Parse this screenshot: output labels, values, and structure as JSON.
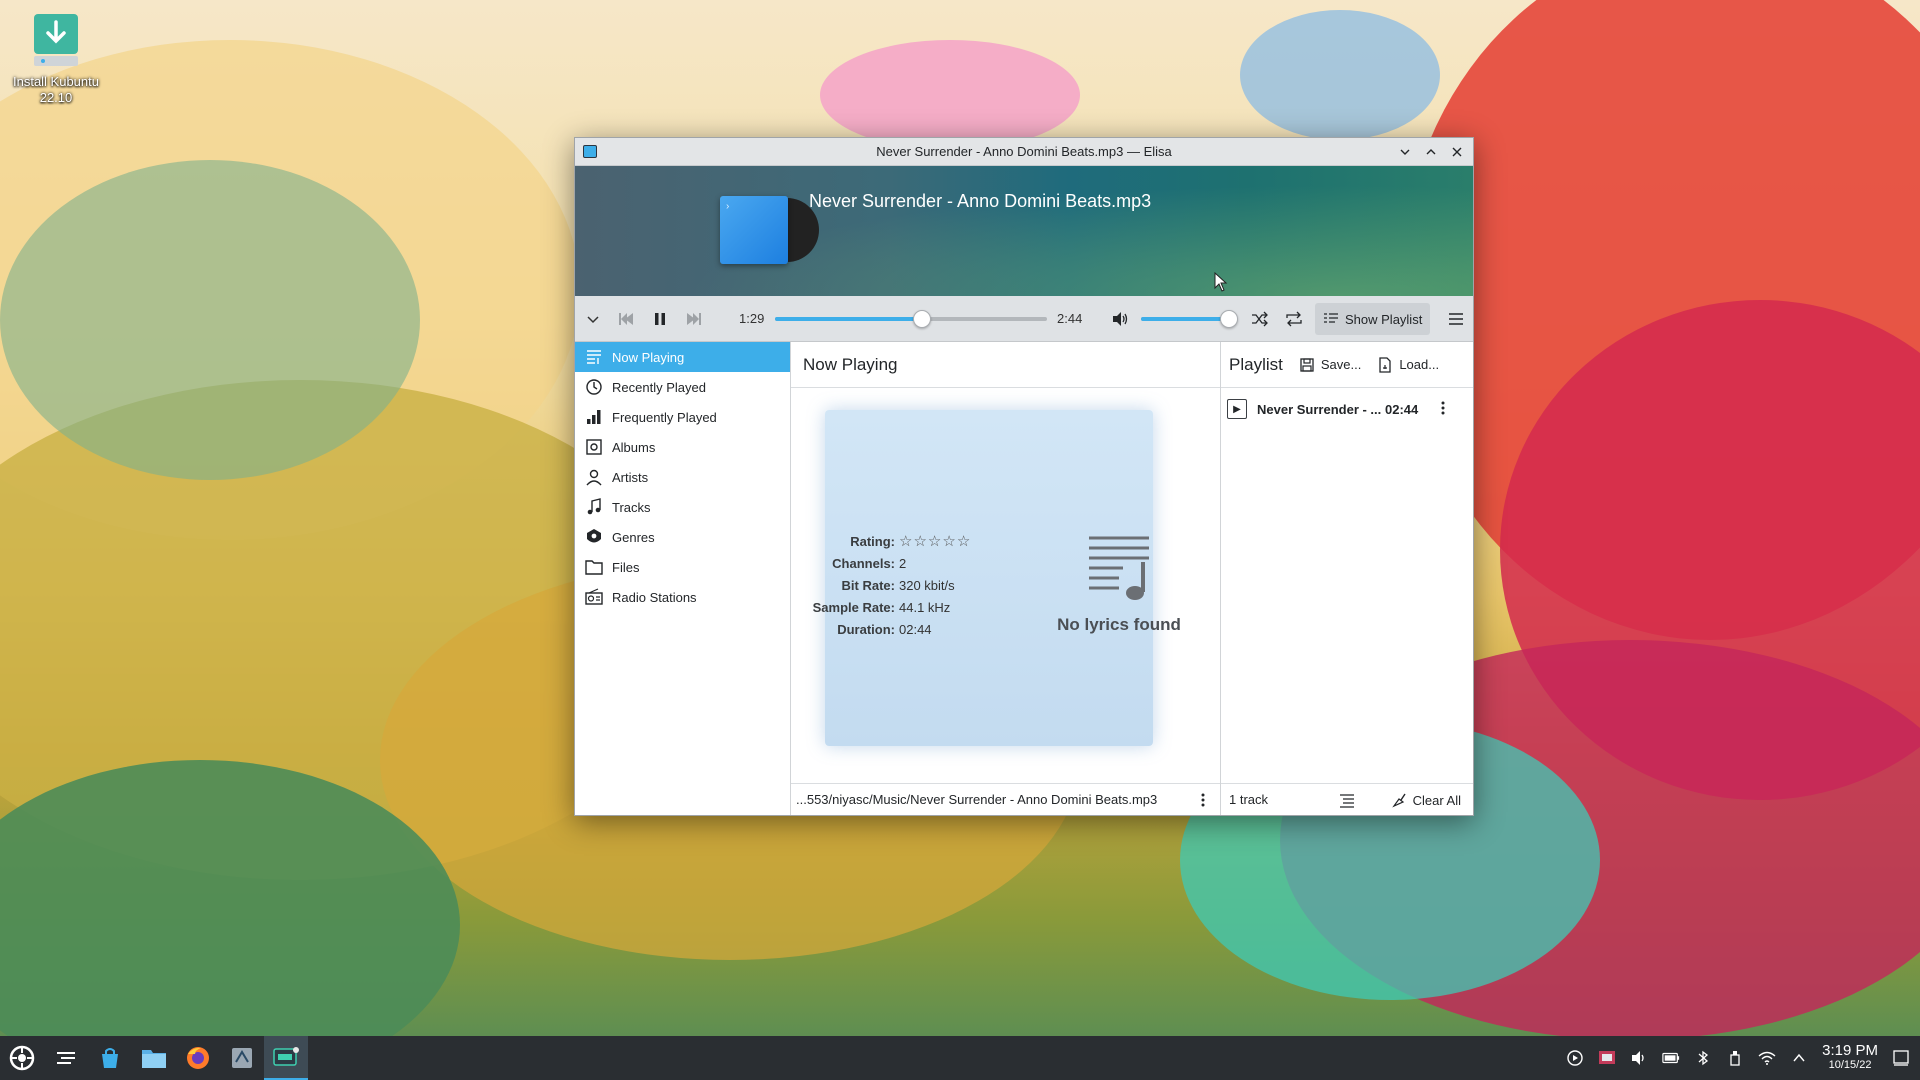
{
  "desktop": {
    "icon_label_line1": "Install Kubuntu",
    "icon_label_line2": "22.10"
  },
  "window": {
    "title": "Never Surrender - Anno Domini Beats.mp3 — Elisa",
    "controls": [
      "minimize-icon",
      "maximize-icon",
      "close-icon"
    ]
  },
  "header": {
    "track_title": "Never Surrender - Anno Domini Beats.mp3"
  },
  "transport": {
    "elapsed": "1:29",
    "total": "2:44",
    "progress_fraction": 0.54,
    "volume_fraction": 1.0,
    "show_playlist_label": "Show Playlist"
  },
  "sidebar": {
    "items": [
      {
        "label": "Now Playing",
        "icon": "now-playing-icon",
        "active": true
      },
      {
        "label": "Recently Played",
        "icon": "clock-icon"
      },
      {
        "label": "Frequently Played",
        "icon": "bar-chart-icon"
      },
      {
        "label": "Albums",
        "icon": "album-icon"
      },
      {
        "label": "Artists",
        "icon": "person-icon"
      },
      {
        "label": "Tracks",
        "icon": "music-note-icon"
      },
      {
        "label": "Genres",
        "icon": "genre-icon"
      },
      {
        "label": "Files",
        "icon": "folder-icon"
      },
      {
        "label": "Radio Stations",
        "icon": "radio-icon"
      }
    ]
  },
  "now_playing": {
    "title": "Now Playing",
    "meta": [
      {
        "key": "Rating:",
        "value": ""
      },
      {
        "key": "Channels:",
        "value": "2"
      },
      {
        "key": "Bit Rate:",
        "value": "320 kbit/s"
      },
      {
        "key": "Sample Rate:",
        "value": "44.1 kHz"
      },
      {
        "key": "Duration:",
        "value": "02:44"
      }
    ],
    "rating_stars": 0,
    "rating_max": 5,
    "lyrics_text": "No lyrics found",
    "file_path": "...553/niyasc/Music/Never Surrender - Anno Domini Beats.mp3"
  },
  "playlist": {
    "title": "Playlist",
    "save_label": "Save...",
    "load_label": "Load...",
    "rows": [
      {
        "name": "Never Surrender - ...",
        "duration": "02:44"
      }
    ],
    "track_count": "1 track",
    "clear_label": "Clear All"
  },
  "taskbar": {
    "time": "3:19 PM",
    "date": "10/15/22"
  },
  "colors": {
    "accent": "#3daee9",
    "taskbar": "#2a2e32"
  }
}
